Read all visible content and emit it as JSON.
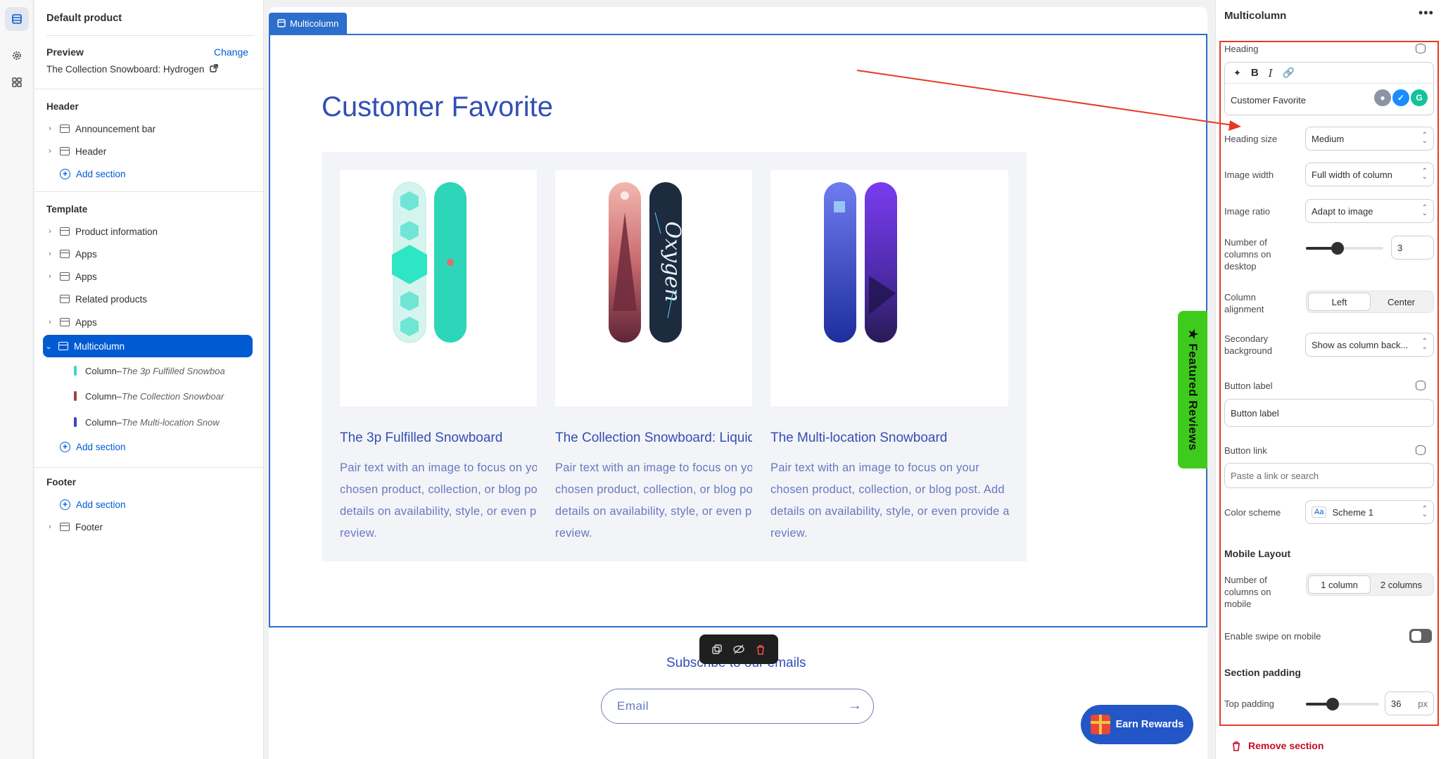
{
  "tree": {
    "store_title": "Default product",
    "preview_label": "Preview",
    "change_link": "Change",
    "preview_value": "The Collection Snowboard: Hydrogen",
    "header_group": "Header",
    "header_items": [
      "Announcement bar",
      "Header"
    ],
    "add_section": "Add section",
    "template_group": "Template",
    "template_items": [
      "Product information",
      "Apps",
      "Apps",
      "Related products",
      "Apps",
      "Multicolumn"
    ],
    "columns": [
      {
        "prefix": "Column",
        "sep": " – ",
        "name": "The 3p Fulfilled Snowboa",
        "color": "#3ed8c2"
      },
      {
        "prefix": "Column",
        "sep": " – ",
        "name": "The Collection Snowboar",
        "color": "#a0433d"
      },
      {
        "prefix": "Column",
        "sep": " – ",
        "name": "The Multi-location Snow",
        "color": "#3a46c9"
      }
    ],
    "footer_group": "Footer",
    "footer_items": [
      "Footer"
    ]
  },
  "preview": {
    "tag": "Multicolumn",
    "heading": "Customer Favorite",
    "cards": [
      {
        "title": "The 3p Fulfilled Snowboard",
        "text": "Pair text with an image to focus on your chosen product, collection, or blog post. Add details on availability, style, or even provide a review."
      },
      {
        "title": "The Collection Snowboard: Liquid",
        "text": "Pair text with an image to focus on your chosen product, collection, or blog post. Add details on availability, style, or even provide a review."
      },
      {
        "title": "The Multi-location Snowboard",
        "text": "Pair text with an image to focus on your chosen product, collection, or blog post. Add details on availability, style, or even provide a review."
      }
    ],
    "subscribe": "Subscribe to our emails",
    "email_placeholder": "Email",
    "reviews_tab": "Featured Reviews",
    "earn_rewards": "Earn Rewards"
  },
  "settings": {
    "title": "Multicolumn",
    "heading_label": "Heading",
    "heading_value": "Customer Favorite",
    "heading_size_label": "Heading size",
    "heading_size_value": "Medium",
    "image_width_label": "Image width",
    "image_width_value": "Full width of column",
    "image_ratio_label": "Image ratio",
    "image_ratio_value": "Adapt to image",
    "columns_desktop_label": "Number of columns on desktop",
    "columns_desktop_value": "3",
    "columns_desktop_fraction": 0.4,
    "column_alignment_label": "Column alignment",
    "alignment_options": [
      "Left",
      "Center"
    ],
    "alignment_selected": "Left",
    "secondary_bg_label": "Secondary background",
    "secondary_bg_value": "Show as column back...",
    "button_label_label": "Button label",
    "button_label_value": "Button label",
    "button_link_label": "Button link",
    "button_link_placeholder": "Paste a link or search",
    "color_scheme_label": "Color scheme",
    "color_scheme_value": "Scheme 1",
    "color_scheme_icon": "Aa",
    "mobile_layout_heading": "Mobile Layout",
    "columns_mobile_label": "Number of columns on mobile",
    "mobile_options": [
      "1 column",
      "2 columns"
    ],
    "mobile_selected": "1 column",
    "swipe_label": "Enable swipe on mobile",
    "swipe_enabled": false,
    "section_padding_heading": "Section padding",
    "top_padding_label": "Top padding",
    "top_padding_value": "36",
    "top_padding_unit": "px",
    "top_padding_fraction": 0.36,
    "remove_section": "Remove section"
  },
  "colors": {
    "accent": "#005bd3",
    "brand_heading": "#334fb4",
    "annotation": "#e53a25",
    "danger": "#c70a24",
    "reviews_green": "#3fcb1c"
  }
}
